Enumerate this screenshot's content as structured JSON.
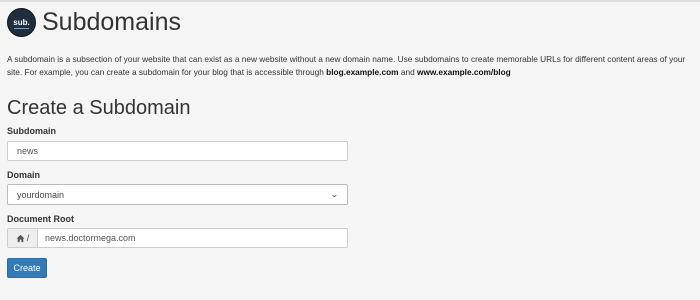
{
  "header": {
    "logo_text": "sub.",
    "title": "Subdomains"
  },
  "description": {
    "text_before": "A subdomain is a subsection of your website that can exist as a new website without a new domain name. Use subdomains to create memorable URLs for different content areas of your site. For example, you can create a subdomain for your blog that is accessible through ",
    "example_1": "blog.example.com",
    "text_between": " and ",
    "example_2": "www.example.com/blog"
  },
  "form": {
    "title": "Create a Subdomain",
    "subdomain": {
      "label": "Subdomain",
      "value": "news"
    },
    "domain": {
      "label": "Domain",
      "selected": "yourdomain"
    },
    "document_root": {
      "label": "Document Root",
      "prefix": "/",
      "value": "news.doctormega.com"
    },
    "submit_label": "Create"
  },
  "icons": {
    "home": "home-icon",
    "chevron": "chevron-down-icon"
  },
  "colors": {
    "primary_button": "#337ab7",
    "logo_bg": "#1f2d3d",
    "background": "#f5f5f5"
  }
}
